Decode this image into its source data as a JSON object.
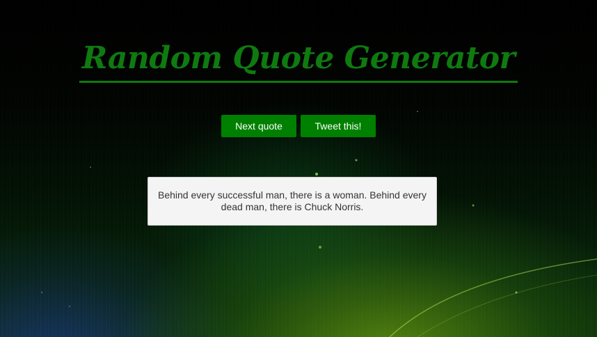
{
  "page": {
    "title": "Random Quote Generator"
  },
  "buttons": {
    "next_label": "Next quote",
    "tweet_label": "Tweet this!"
  },
  "quote": {
    "text": "Behind every successful man, there is a woman. Behind every dead man, there is Chuck Norris."
  },
  "colors": {
    "accent": "#008000",
    "title": "#0f7a10",
    "quote_bg": "#f4f4f4",
    "quote_text": "#333333"
  }
}
